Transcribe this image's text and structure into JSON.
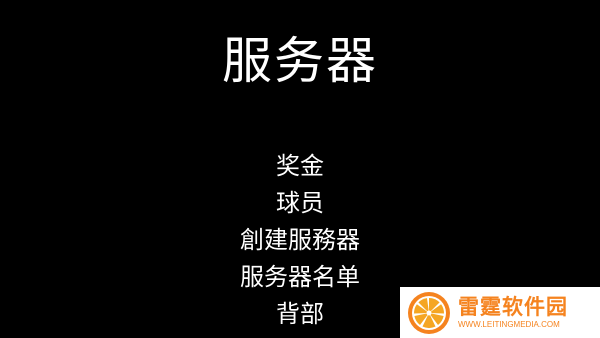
{
  "screen": {
    "title": "服务器",
    "menu_items": [
      {
        "label": "奖金"
      },
      {
        "label": "球员"
      },
      {
        "label": "創建服務器"
      },
      {
        "label": "服务器名单"
      },
      {
        "label": "背部"
      }
    ]
  },
  "watermark": {
    "name": "雷霆软件园",
    "url": "WWW.LEITINGMEDIA.COM",
    "logo_icon": "orange-slice-logo",
    "color": "#f5831f"
  },
  "colors": {
    "background": "#000000",
    "text": "#ffffff"
  }
}
